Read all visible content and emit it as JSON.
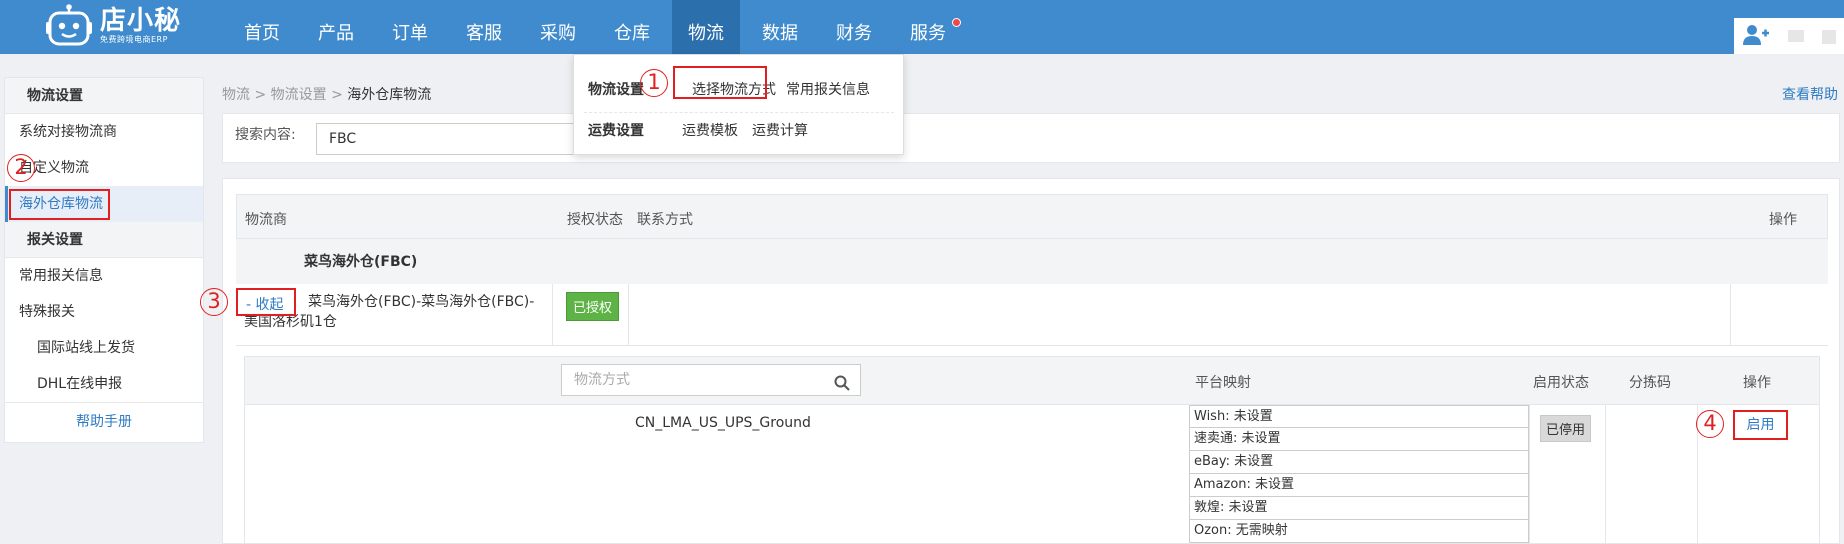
{
  "app": {
    "logo_main": "店小秘",
    "logo_sub": "免费跨境电商ERP"
  },
  "nav": {
    "items": [
      "首页",
      "产品",
      "订单",
      "客服",
      "采购",
      "仓库",
      "物流",
      "数据",
      "财务",
      "服务"
    ],
    "active": "物流"
  },
  "dropdown": {
    "group1_title": "物流设置",
    "group1_links": [
      "选择物流方式",
      "常用报关信息"
    ],
    "group2_title": "运费设置",
    "group2_links": [
      "运费模板",
      "运费计算"
    ]
  },
  "sidebar": {
    "section1": "物流设置",
    "items1": [
      "系统对接物流商",
      "自定义物流",
      "海外仓库物流"
    ],
    "section2": "报关设置",
    "items2": [
      "常用报关信息",
      "特殊报关",
      "国际站线上发货",
      "DHL在线申报"
    ],
    "help": "帮助手册"
  },
  "breadcrumb": {
    "items": [
      "物流",
      "物流设置",
      "海外仓库物流"
    ],
    "sep": ">"
  },
  "help_link": "查看帮助",
  "search": {
    "label": "搜索内容:",
    "value": "FBC"
  },
  "table": {
    "headers": [
      "物流商",
      "授权状态",
      "联系方式",
      "操作"
    ],
    "provider_title": "菜鸟海外仓(FBC)",
    "collapse": "- 收起",
    "provider_full": "菜鸟海外仓(FBC)-菜鸟海外仓(FBC)-美国洛杉矶1仓",
    "auth_status": "已授权"
  },
  "sub_table": {
    "search_placeholder": "物流方式",
    "headers": [
      "平台映射",
      "启用状态",
      "分拣码",
      "操作"
    ],
    "method": "CN_LMA_US_UPS_Ground",
    "mappings": [
      "Wish: 未设置",
      "速卖通: 未设置",
      "eBay: 未设置",
      "Amazon: 未设置",
      "敦煌: 未设置",
      "Ozon: 无需映射"
    ],
    "status": "已停用",
    "action": "启用"
  },
  "markers": [
    "1",
    "2",
    "3",
    "4"
  ],
  "colors": {
    "topbar": "#3f8bce",
    "nav_active": "#2b6fac",
    "link": "#2f7bc4",
    "highlight": "#e02020",
    "authorized": "#5db345"
  }
}
